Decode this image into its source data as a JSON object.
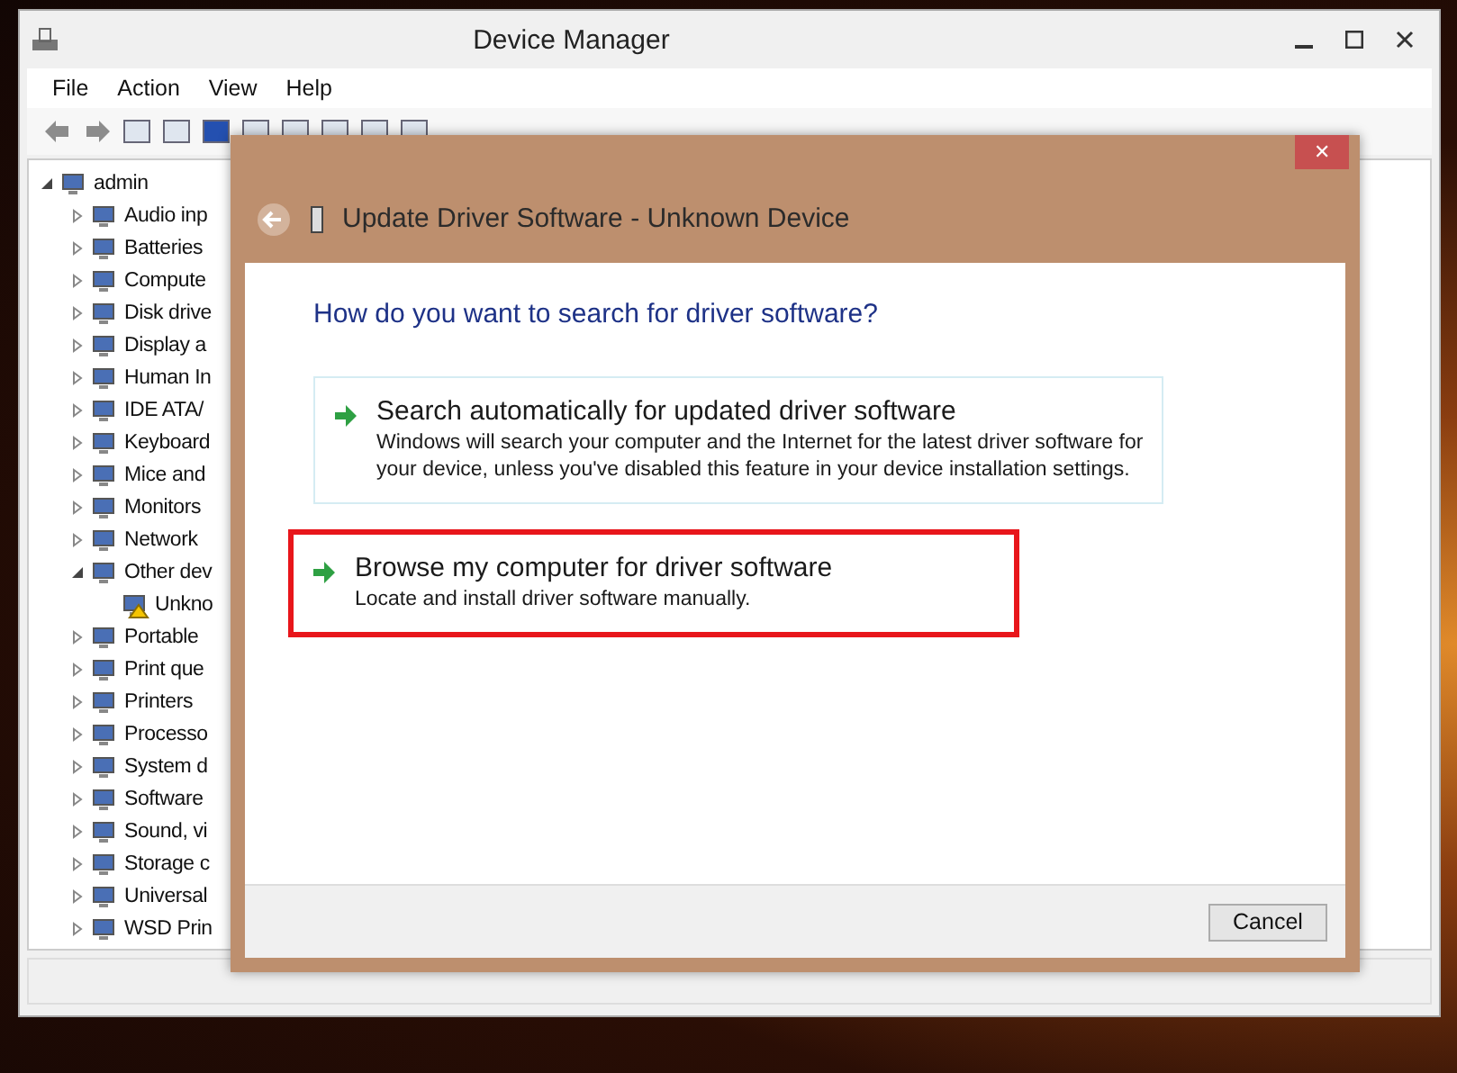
{
  "window": {
    "title": "Device Manager"
  },
  "menu": [
    "File",
    "Action",
    "View",
    "Help"
  ],
  "tree": [
    {
      "label": "admin",
      "expanded": true,
      "children": [
        {
          "label": "Audio inp",
          "expanded": false
        },
        {
          "label": "Batteries",
          "expanded": false
        },
        {
          "label": "Compute",
          "expanded": false
        },
        {
          "label": "Disk drive",
          "expanded": false
        },
        {
          "label": "Display a",
          "expanded": false
        },
        {
          "label": "Human In",
          "expanded": false
        },
        {
          "label": "IDE ATA/",
          "expanded": false
        },
        {
          "label": "Keyboard",
          "expanded": false
        },
        {
          "label": "Mice and",
          "expanded": false
        },
        {
          "label": "Monitors",
          "expanded": false
        },
        {
          "label": "Network",
          "expanded": false
        },
        {
          "label": "Other dev",
          "expanded": true,
          "children": [
            {
              "label": "Unkno",
              "warning": true
            }
          ]
        },
        {
          "label": "Portable",
          "expanded": false
        },
        {
          "label": "Print que",
          "expanded": false
        },
        {
          "label": "Printers",
          "expanded": false
        },
        {
          "label": "Processo",
          "expanded": false
        },
        {
          "label": "System d",
          "expanded": false
        },
        {
          "label": "Software",
          "expanded": false
        },
        {
          "label": "Sound, vi",
          "expanded": false
        },
        {
          "label": "Storage c",
          "expanded": false
        },
        {
          "label": "Universal",
          "expanded": false
        },
        {
          "label": "WSD Prin",
          "expanded": false
        }
      ]
    }
  ],
  "dialog": {
    "close": "✕",
    "title": "Update Driver Software - Unknown Device",
    "question": "How do you want to search for driver software?",
    "options": [
      {
        "title": "Search automatically for updated driver software",
        "description": "Windows will search your computer and the Internet for the latest driver software for your device, unless you've disabled this feature in your device installation settings.",
        "highlighted": false
      },
      {
        "title": "Browse my computer for driver software",
        "description": "Locate and install driver software manually.",
        "highlighted": true
      }
    ],
    "cancel": "Cancel"
  }
}
